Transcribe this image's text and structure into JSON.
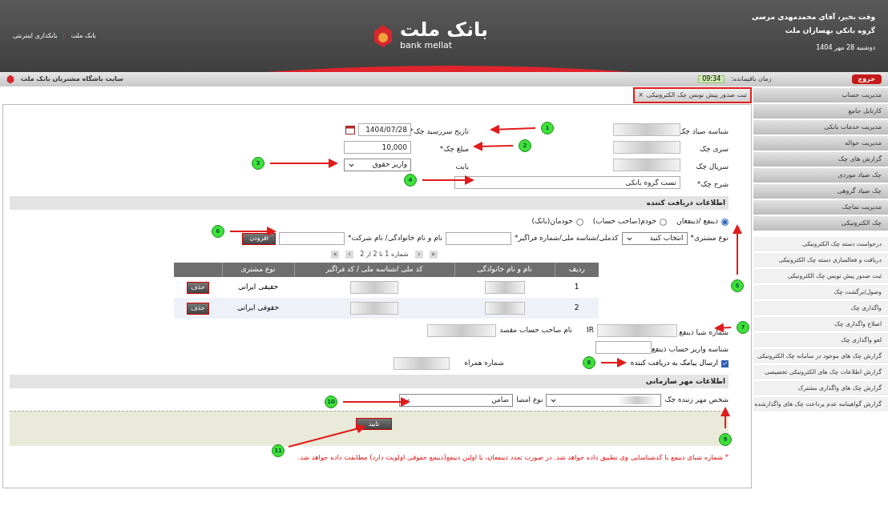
{
  "header": {
    "greeting": "وقت بخیر، آقای محمدمهدی مرسی",
    "company": "گروه بانکی بهسازان ملت",
    "date": "دوشنبه 28 مهر 1404",
    "logo_fa": "بانک ملت",
    "logo_en": "bank mellat",
    "links": [
      "بانک ملت",
      "بانکداری اینترنتی"
    ]
  },
  "top_bar": {
    "logout": "خروج",
    "timer_label": "زمان باقیمانده:",
    "timer": "09:34",
    "site_title": "سایت باشگاه مشتریان بانک ملت"
  },
  "sidebar": {
    "menus": [
      {
        "label": "مدیریت حساب"
      },
      {
        "label": "کارتابل جامع"
      },
      {
        "label": "مدیریت خدمات بانکی"
      },
      {
        "label": "مدیریت حواله"
      },
      {
        "label": "گزارش های چک"
      },
      {
        "label": "چک صیاد موردی"
      },
      {
        "label": "چک صیاد گروهی"
      },
      {
        "label": "مدیریت نماچک"
      },
      {
        "label": "چک الکترونیکی"
      }
    ],
    "submenu": [
      "درخواست دسته چک الکترونیکی",
      "دریافت و فعالسازی دسته چک الکترونیکی",
      "ثبت صدور پیش نویس چک الکترونیکی",
      "وصول/برگشت چک",
      "واگذاری چک",
      "اصلاح واگذاری چک",
      "لغو واگذاری چک",
      "گزارش چک های موجود در سامانه چک الکترونیکی",
      "گزارش اطلاعات چک های الکترونیکی تخصیصی",
      "گزارش چک های واگذاری مشترک",
      "گزارش گواهینامه عدم پرداخت چک های واگذارشده"
    ]
  },
  "tab": {
    "label": "ثبت صدور پیش نویس چک الکترونیکی",
    "close": "×"
  },
  "cheque": {
    "sayad_id_label": "شناسه صیاد چک",
    "series_label": "سری چک",
    "serial_label": "سریال چک",
    "due_date_label": "تاریخ سررسید چک*",
    "due_date": "1404/07/28",
    "amount_label": "مبلغ چک*",
    "amount": "10,000",
    "reason_label": "بابت",
    "reason": "واریز حقوق",
    "description_label": "شرح چک*",
    "description": "تست گروه بانکی"
  },
  "recipient": {
    "title": "اطلاعات دریافت کننده",
    "options": [
      {
        "label": "ذینفع /ذینفعان",
        "selected": true
      },
      {
        "label": "خودم(صاحب حساب)",
        "selected": false
      },
      {
        "label": "خودمان(بانک)",
        "selected": false
      }
    ],
    "customer_type_label": "نوع مشتری*",
    "customer_type": "انتخاب کنید",
    "national_id_label": "کدملی/شناسه ملی/شماره فراگیر*",
    "name_label": "نام و نام خانوادگی/ نام شرکت*",
    "add_button": "افزودن",
    "pager": {
      "first": "«",
      "prev": "‹",
      "text": "شماره 1 تا 2 از 2",
      "next": "›",
      "last": "»"
    },
    "table": {
      "columns": [
        "ردیف",
        "نام و نام خانوادگی",
        "کد ملی /شناسه ملی / کد فراگیر",
        "نوع مشتری"
      ],
      "rows": [
        {
          "index": "1",
          "type": "حقیقی ایرانی",
          "action": "حذف"
        },
        {
          "index": "2",
          "type": "حقوقی ایرانی",
          "action": "حذف"
        }
      ]
    },
    "sheba_label": "شماره شبا ذینفع",
    "sheba_prefix": "IR",
    "account_owner_label": "نام صاحب حساب مقصد",
    "deposit_id_label": "شناسه واریز حساب ذینفع",
    "sms": {
      "label": "ارسال پیامک به دریافت کننده",
      "checked": true
    },
    "mobile_label": "شماره همراه"
  },
  "seal": {
    "title": "اطلاعات مهر سازمانی",
    "stamper_label": "شخص مهر زننده چک",
    "signature_type_label": "نوع امضا",
    "signature_type": "ضامن"
  },
  "confirm_button": "تایید",
  "footnote": "* شماره شبای ذینفع با کدشناسایی وی تطبیق داده خواهد شد. در صورت تعدد ذینفعان، با اولین ذینفع(ذینفع حقوقی اولویت دارد) مطابقت داده خواهد شد.",
  "annotations": [
    {
      "number": "1"
    },
    {
      "number": "2"
    },
    {
      "number": "3"
    },
    {
      "number": "4"
    },
    {
      "number": "5"
    },
    {
      "number": "6"
    },
    {
      "number": "7"
    },
    {
      "number": "8"
    },
    {
      "number": "9"
    },
    {
      "number": "10"
    },
    {
      "number": "11"
    }
  ]
}
